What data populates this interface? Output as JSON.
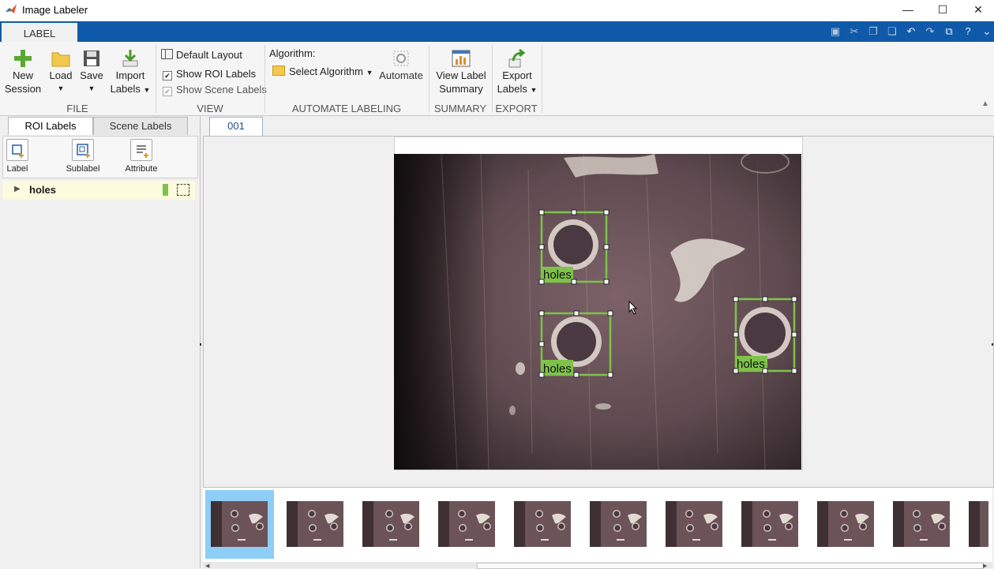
{
  "window": {
    "title": "Image Labeler",
    "minimize": "—",
    "maximize": "☐",
    "close": "✕"
  },
  "ribbon": {
    "active_tab": "LABEL",
    "file": {
      "section": "FILE",
      "new_session": [
        "New",
        "Session"
      ],
      "load": "Load",
      "save": "Save",
      "import_labels": [
        "Import",
        "Labels"
      ]
    },
    "view": {
      "section": "VIEW",
      "default_layout": "Default Layout",
      "show_roi_labels": {
        "label": "Show ROI Labels",
        "checked": true
      },
      "show_scene_labels": {
        "label": "Show Scene Labels",
        "checked": true,
        "enabled": false
      }
    },
    "automate": {
      "section": "AUTOMATE LABELING",
      "algorithm_caption": "Algorithm:",
      "select_algorithm": "Select Algorithm",
      "automate": "Automate"
    },
    "summary": {
      "section": "SUMMARY",
      "view_label_summary": [
        "View Label",
        "Summary"
      ]
    },
    "export": {
      "section": "EXPORT",
      "export_labels": [
        "Export",
        "Labels"
      ]
    }
  },
  "left_panel": {
    "tabs": [
      "ROI Labels",
      "Scene Labels"
    ],
    "tools": [
      "Label",
      "Sublabel",
      "Attribute"
    ],
    "roi_labels": [
      {
        "name": "holes",
        "color": "#7ec24a"
      }
    ]
  },
  "document": {
    "tab": "001"
  },
  "annotations": [
    {
      "label": "holes"
    },
    {
      "label": "holes"
    },
    {
      "label": "holes"
    }
  ],
  "filmstrip": {
    "thumbnail_count": 10,
    "selected_index": 0
  },
  "colors": {
    "ribbon_blue": "#0f5aa8",
    "roi_green": "#7ec24a",
    "selected_thumb": "#8ecdf5"
  }
}
